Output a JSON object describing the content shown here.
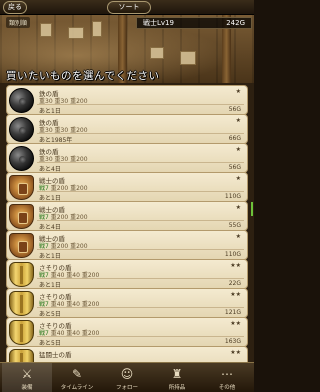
{
  "header": {
    "back_label": "戻る",
    "sort_label": "ソート"
  },
  "scene": {
    "tab_label": "類別順",
    "level": "戦士Lv19",
    "gold": "242G",
    "prompt": "買いたいものを選んでください"
  },
  "items": [
    {
      "icon": "iron-ball",
      "name": "鉄の盾",
      "stats_hl": "",
      "stats": "重30 重30 重200",
      "stars": "★",
      "time": "あと1日",
      "price": "56G"
    },
    {
      "icon": "iron-ball",
      "name": "鉄の盾",
      "stats_hl": "",
      "stats": "重30 重30 重200",
      "stars": "★",
      "time": "あと1985年",
      "price": "66G"
    },
    {
      "icon": "iron-ball",
      "name": "鉄の盾",
      "stats_hl": "",
      "stats": "重30 重30 重200",
      "stars": "★",
      "time": "あと4日",
      "price": "56G"
    },
    {
      "icon": "bronze-shield",
      "name": "戦士の盾",
      "stats_hl": "戦7",
      "stats": "重200 重200",
      "stars": "★",
      "time": "あと1日",
      "price": "110G"
    },
    {
      "icon": "bronze-shield",
      "name": "戦士の盾",
      "stats_hl": "戦7",
      "stats": "重200 重200",
      "stars": "★",
      "time": "あと4日",
      "price": "55G"
    },
    {
      "icon": "bronze-shield",
      "name": "戦士の盾",
      "stats_hl": "戦7",
      "stats": "重200 重200",
      "stars": "★",
      "time": "あと1日",
      "price": "110G"
    },
    {
      "icon": "gold-shield",
      "name": "さそりの盾",
      "stats_hl": "戦7",
      "stats": "重40 重40 重200",
      "stars": "★★",
      "time": "あと1日",
      "price": "22G"
    },
    {
      "icon": "gold-shield",
      "name": "さそりの盾",
      "stats_hl": "戦7",
      "stats": "重40 重40 重200",
      "stars": "★★",
      "time": "あと5日",
      "price": "121G"
    },
    {
      "icon": "gold-shield",
      "name": "さそりの盾",
      "stats_hl": "戦7",
      "stats": "重40 重40 重200",
      "stars": "★★",
      "time": "あと5日",
      "price": "163G"
    },
    {
      "icon": "gold-shield",
      "name": "猛闘士の盾",
      "stats_hl": "",
      "stats": "",
      "stars": "★★",
      "time": "",
      "price": ""
    }
  ],
  "nav": [
    {
      "label": "装備",
      "icon": "equipment-icon",
      "glyph": "⚔",
      "active": true
    },
    {
      "label": "タイムライン",
      "icon": "timeline-icon",
      "glyph": "✎",
      "active": false
    },
    {
      "label": "フォロー",
      "icon": "follow-icon",
      "glyph": "☺",
      "active": false
    },
    {
      "label": "所持品",
      "icon": "items-icon",
      "glyph": "♜",
      "active": false
    },
    {
      "label": "その他",
      "icon": "more-icon",
      "glyph": "⋯",
      "active": false
    }
  ],
  "colors": {
    "accent_green": "#2a7a1e",
    "card_bg": "#f4ead0"
  }
}
